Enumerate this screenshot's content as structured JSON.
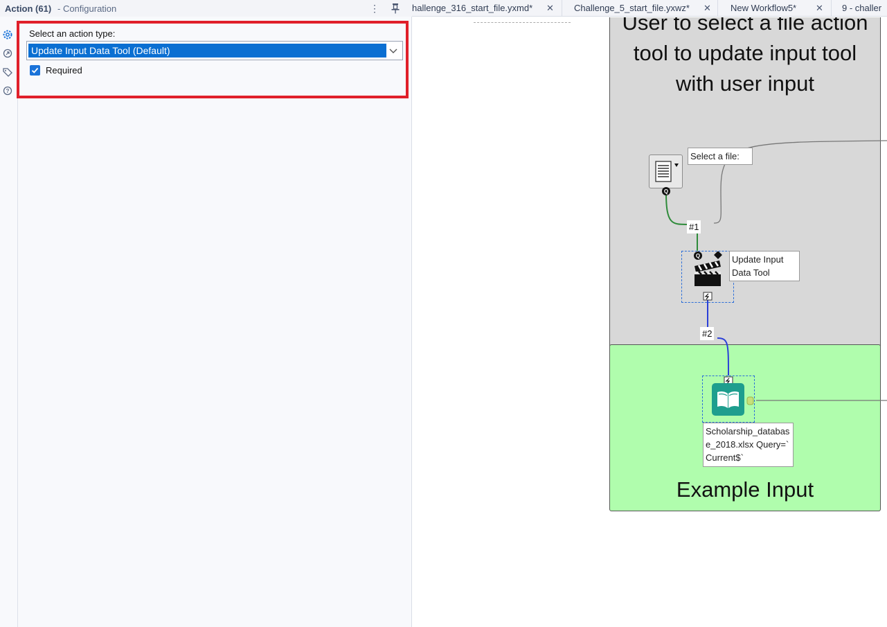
{
  "panel": {
    "title": "Action (61)",
    "subtitle": "- Configuration",
    "more_icon": "vertical-dots-icon",
    "pin_icon": "pin-icon"
  },
  "side_icons": [
    "gear-icon",
    "connection-icon",
    "tag-icon",
    "help-icon"
  ],
  "settings": {
    "action_type_label": "Select an action type:",
    "action_type_value": "Update Input Data Tool (Default)",
    "required_label": "Required",
    "required_checked": true
  },
  "tabs": [
    {
      "label": "hallenge_316_start_file.yxmd*"
    },
    {
      "label": "Challenge_5_start_file.yxwz*"
    },
    {
      "label": "New Workflow5*"
    },
    {
      "label": "9 - challer"
    }
  ],
  "canvas": {
    "top_container_caption": "User to select a file action tool to update input tool with user input",
    "bottom_container_caption": "Example Input",
    "select_file_annotation": "Select a file:",
    "update_tool_annotation": "Update Input Data Tool",
    "input_tool_annotation": "Scholarship_database_2018.xlsx Query=`Current$`",
    "connection_1": "#1",
    "connection_2": "#2"
  },
  "colors": {
    "highlight_border": "#e0202a",
    "selection_blue": "#0a6fd2",
    "container_grey": "#d8d8d8",
    "container_green": "#b0fdad"
  }
}
